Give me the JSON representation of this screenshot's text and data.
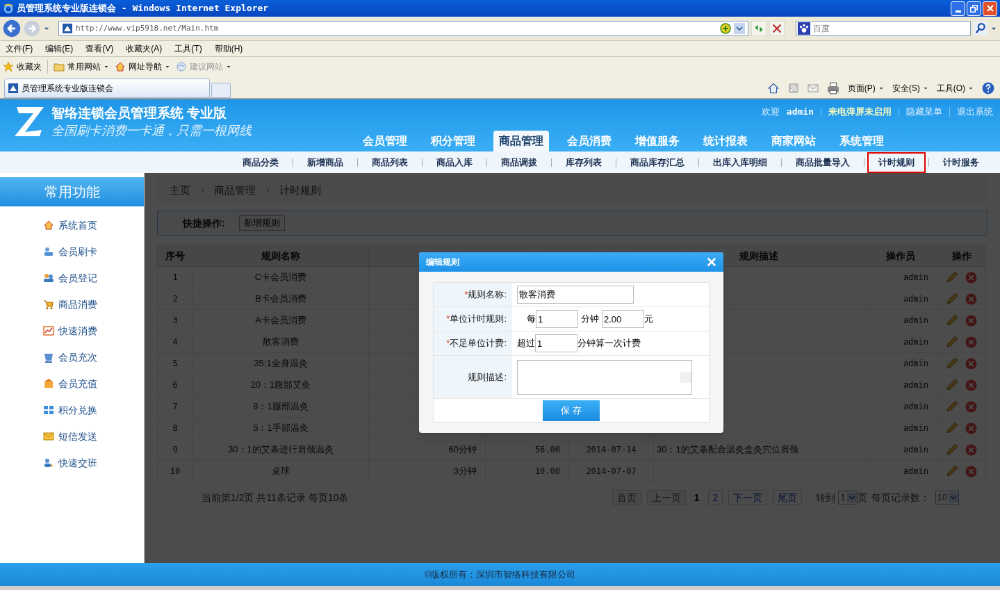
{
  "browser": {
    "title": "员管理系统专业版连锁会 - Windows Internet Explorer",
    "url": "http://www.vip5918.net/Main.htm",
    "search_placeholder": "百度",
    "menu": [
      "文件(F)",
      "编辑(E)",
      "查看(V)",
      "收藏夹(A)",
      "工具(T)",
      "帮助(H)"
    ],
    "favorites": [
      {
        "label": "收藏夹",
        "kind": "star",
        "disabled": false
      },
      {
        "label": "常用网站",
        "kind": "folder",
        "disabled": false
      },
      {
        "label": "网址导航",
        "kind": "home",
        "disabled": false
      },
      {
        "label": "建议网站",
        "kind": "globe",
        "disabled": true
      }
    ],
    "tab_title": "员管理系统专业版连锁会",
    "commands": [
      "页面(P)",
      "安全(S)",
      "工具(O)"
    ]
  },
  "header": {
    "title": "智络连锁会员管理系统 专业版",
    "slogan": "全国刷卡消费一卡通，只需一根网线",
    "welcome": "欢迎",
    "user": "admin",
    "links": [
      "来电弹屏未启用",
      "隐藏菜单",
      "退出系统"
    ],
    "nav": [
      {
        "label": "会员管理",
        "selected": false
      },
      {
        "label": "积分管理",
        "selected": false
      },
      {
        "label": "商品管理",
        "selected": true
      },
      {
        "label": "会员消费",
        "selected": false
      },
      {
        "label": "增值服务",
        "selected": false
      },
      {
        "label": "统计报表",
        "selected": false
      },
      {
        "label": "商家网站",
        "selected": false
      },
      {
        "label": "系统管理",
        "selected": false
      }
    ],
    "subnav": [
      {
        "label": "商品分类",
        "selected": false
      },
      {
        "label": "新增商品",
        "selected": false
      },
      {
        "label": "商品列表",
        "selected": false
      },
      {
        "label": "商品入库",
        "selected": false
      },
      {
        "label": "商品调拨",
        "selected": false
      },
      {
        "label": "库存列表",
        "selected": false
      },
      {
        "label": "商品库存汇总",
        "selected": false
      },
      {
        "label": "出库入库明细",
        "selected": false
      },
      {
        "label": "商品批量导入",
        "selected": false
      },
      {
        "label": "计时规则",
        "selected": true
      },
      {
        "label": "计时服务",
        "selected": false
      }
    ]
  },
  "sidebar": {
    "title": "常用功能",
    "items": [
      {
        "label": "系统首页",
        "kind": "home"
      },
      {
        "label": "会员刷卡",
        "kind": "user"
      },
      {
        "label": "会员登记",
        "kind": "users"
      },
      {
        "label": "商品消费",
        "kind": "cart"
      },
      {
        "label": "快速消费",
        "kind": "chart"
      },
      {
        "label": "会员充次",
        "kind": "cup"
      },
      {
        "label": "会员充值",
        "kind": "coins"
      },
      {
        "label": "积分兑换",
        "kind": "grid"
      },
      {
        "label": "短信发送",
        "kind": "mail"
      },
      {
        "label": "快速交班",
        "kind": "swap"
      }
    ]
  },
  "breadcrumb": [
    "主页",
    "商品管理",
    "计时规则"
  ],
  "quick": {
    "label": "快捷操作:",
    "button": "新增规则"
  },
  "table": {
    "columns": [
      "序号",
      "规则名称",
      null,
      null,
      null,
      "规则描述",
      "操作员",
      "操作"
    ],
    "rows": [
      [
        "1",
        "C卡会员消费",
        null,
        null,
        null,
        null,
        "admin"
      ],
      [
        "2",
        "B卡会员消费",
        null,
        null,
        null,
        null,
        "admin"
      ],
      [
        "3",
        "A卡会员消费",
        null,
        null,
        null,
        null,
        "admin"
      ],
      [
        "4",
        "散客消费",
        null,
        null,
        null,
        null,
        "admin"
      ],
      [
        "5",
        "35:1全身温灸",
        null,
        null,
        null,
        null,
        "admin"
      ],
      [
        "6",
        "20：1腹部艾灸",
        null,
        null,
        null,
        null,
        "admin"
      ],
      [
        "7",
        "8：1腿部温灸",
        null,
        null,
        null,
        null,
        "admin"
      ],
      [
        "8",
        "5：1手部温灸",
        null,
        null,
        null,
        null,
        "admin"
      ],
      [
        "9",
        "30：1的艾条进行肩颈温灸",
        "60分钟",
        "56.00",
        "2014-07-14",
        "30：1的艾条配合温灸盒灸穴位肩颈",
        "admin"
      ],
      [
        "10",
        "桌球",
        "3分钟",
        "10.00",
        "2014-07-07",
        null,
        "admin"
      ]
    ]
  },
  "pagination": {
    "summary": "当前第1/2页 共11条记录 每页10条",
    "pages": [
      {
        "label": "首页",
        "disabled": true,
        "current": false
      },
      {
        "label": "上一页",
        "disabled": true,
        "current": false
      },
      {
        "label": "1",
        "disabled": false,
        "current": true
      },
      {
        "label": "2",
        "disabled": false,
        "current": false
      },
      {
        "label": "下一页",
        "disabled": false,
        "current": false
      },
      {
        "label": "尾页",
        "disabled": false,
        "current": false
      }
    ],
    "goto": "转到",
    "page_value": "1",
    "page_suffix": "页",
    "per_page_label": "每页记录数：",
    "per_page_value": "10"
  },
  "modal": {
    "title": "编辑规则",
    "name_mark": "*",
    "unit_mark": "*",
    "partial_mark": "*",
    "name_label": "规则名称:",
    "name_value": "散客消费",
    "unit_label": "单位计时规则:",
    "unit_prefix": "每",
    "unit_minutes": "1",
    "unit_mid": "分钟",
    "unit_price": "2.00",
    "unit_suffix": "元",
    "partial_label": "不足单位计费:",
    "partial_prefix": "超过",
    "partial_minutes": "1",
    "partial_suffix": "分钟算一次计费",
    "desc_label": "规则描述:",
    "save": "保 存"
  },
  "footer": "©版权所有：深圳市智络科技有限公司"
}
